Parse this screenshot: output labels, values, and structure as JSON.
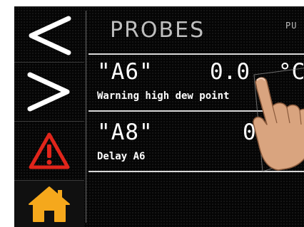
{
  "header": {
    "title": "PROBES",
    "extra": "PU"
  },
  "sidebar": {
    "back_icon": "chevron-left-icon",
    "forward_icon": "chevron-right-icon",
    "alarm_icon": "warning-triangle-icon",
    "home_icon": "home-icon"
  },
  "probes": [
    {
      "name": "\"A6\"",
      "value": "0.0",
      "unit": "°C",
      "description": "Warning high dew point"
    },
    {
      "name": "\"A8\"",
      "value": "0",
      "unit": "",
      "description": "Delay A6"
    }
  ],
  "colors": {
    "background": "#050505",
    "text": "#ffffff",
    "title": "#bfbfbf",
    "alarm": "#e0251b",
    "home": "#f5a81c"
  }
}
